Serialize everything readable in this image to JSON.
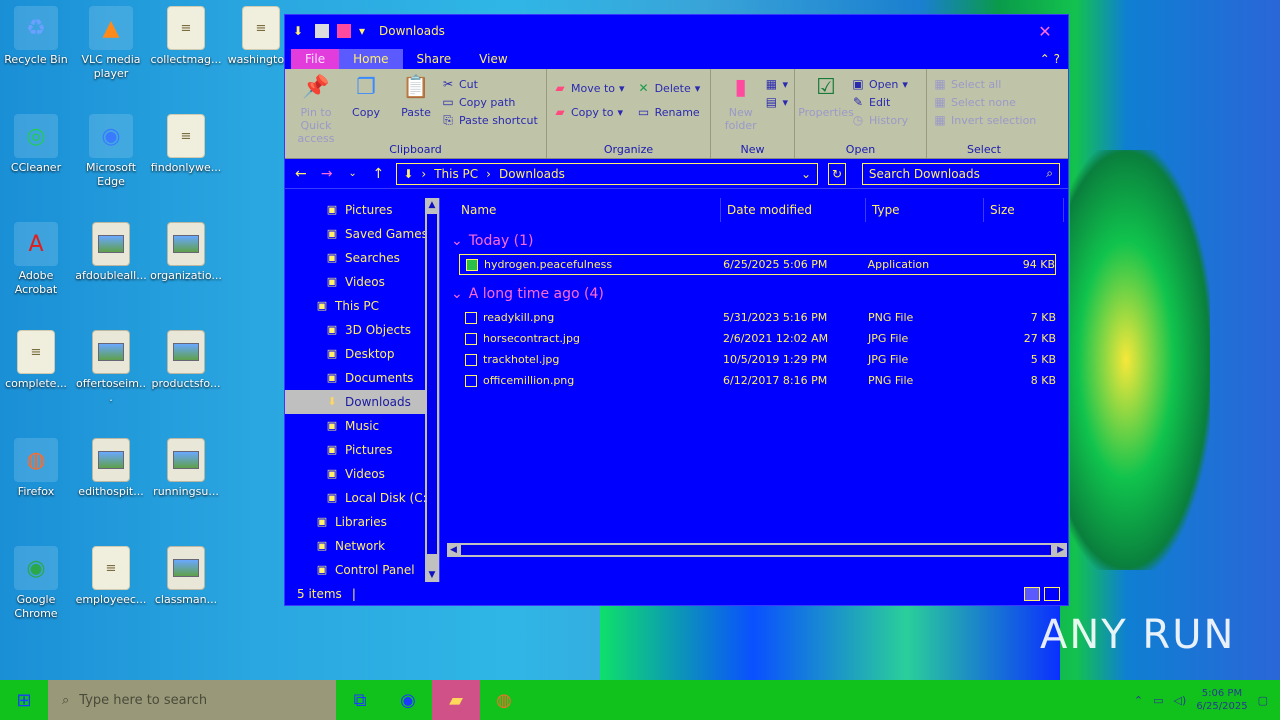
{
  "desktop": {
    "icons": [
      {
        "label": "Recycle Bin",
        "icon": "recycle-bin-icon"
      },
      {
        "label": "VLC media player",
        "icon": "vlc-icon"
      },
      {
        "label": "collectmag...",
        "icon": "document-icon"
      },
      {
        "label": "washingto...",
        "icon": "document-icon"
      },
      {
        "label": "CCleaner",
        "icon": "ccleaner-icon"
      },
      {
        "label": "Microsoft Edge",
        "icon": "edge-icon"
      },
      {
        "label": "findonlywe...",
        "icon": "document-icon"
      },
      {
        "label": "Adobe Acrobat",
        "icon": "acrobat-icon"
      },
      {
        "label": "afdoubleall...",
        "icon": "image-icon"
      },
      {
        "label": "organizatio...",
        "icon": "image-icon"
      },
      {
        "label": "complete...",
        "icon": "document-icon"
      },
      {
        "label": "offertoseim...",
        "icon": "image-icon"
      },
      {
        "label": "productsfo...",
        "icon": "image-icon"
      },
      {
        "label": "Firefox",
        "icon": "firefox-icon"
      },
      {
        "label": "edithospit...",
        "icon": "image-icon"
      },
      {
        "label": "runningsu...",
        "icon": "image-icon"
      },
      {
        "label": "Google Chrome",
        "icon": "chrome-icon"
      },
      {
        "label": "employeec...",
        "icon": "document-icon"
      },
      {
        "label": "classman...",
        "icon": "image-icon"
      }
    ]
  },
  "window": {
    "title": "Downloads",
    "tabs": {
      "file": "File",
      "home": "Home",
      "share": "Share",
      "view": "View"
    },
    "ribbon": {
      "clipboard": {
        "label": "Clipboard",
        "pin": "Pin to Quick access",
        "copy": "Copy",
        "paste": "Paste",
        "cut": "Cut",
        "copy_path": "Copy path",
        "paste_shortcut": "Paste shortcut"
      },
      "organize": {
        "label": "Organize",
        "move_to": "Move to",
        "copy_to": "Copy to",
        "delete": "Delete",
        "rename": "Rename"
      },
      "new": {
        "label": "New",
        "new_folder": "New folder"
      },
      "open": {
        "label": "Open",
        "properties": "Properties",
        "open": "Open",
        "edit": "Edit",
        "history": "History"
      },
      "select": {
        "label": "Select",
        "select_all": "Select all",
        "select_none": "Select none",
        "invert": "Invert selection"
      }
    },
    "address": {
      "parts": [
        "This PC",
        "Downloads"
      ]
    },
    "search_placeholder": "Search Downloads",
    "nav": [
      {
        "label": "Pictures",
        "icon": "pictures-icon",
        "indent": 1
      },
      {
        "label": "Saved Games",
        "icon": "saved-games-icon",
        "indent": 1
      },
      {
        "label": "Searches",
        "icon": "searches-icon",
        "indent": 1
      },
      {
        "label": "Videos",
        "icon": "videos-icon",
        "indent": 1
      },
      {
        "label": "This PC",
        "icon": "this-pc-icon",
        "indent": 0
      },
      {
        "label": "3D Objects",
        "icon": "3d-objects-icon",
        "indent": 1
      },
      {
        "label": "Desktop",
        "icon": "desktop-icon",
        "indent": 1
      },
      {
        "label": "Documents",
        "icon": "documents-icon",
        "indent": 1
      },
      {
        "label": "Downloads",
        "icon": "downloads-icon",
        "indent": 1,
        "selected": true
      },
      {
        "label": "Music",
        "icon": "music-icon",
        "indent": 1
      },
      {
        "label": "Pictures",
        "icon": "pictures-icon",
        "indent": 1
      },
      {
        "label": "Videos",
        "icon": "videos-icon",
        "indent": 1
      },
      {
        "label": "Local Disk (C:)",
        "icon": "local-disk-icon",
        "indent": 1
      },
      {
        "label": "Libraries",
        "icon": "libraries-icon",
        "indent": 0
      },
      {
        "label": "Network",
        "icon": "network-icon",
        "indent": 0
      },
      {
        "label": "Control Panel",
        "icon": "control-panel-icon",
        "indent": 0
      }
    ],
    "columns": {
      "name": "Name",
      "date": "Date modified",
      "type": "Type",
      "size": "Size"
    },
    "groups": [
      {
        "title": "Today (1)",
        "files": [
          {
            "name": "hydrogen.peacefulness",
            "date": "6/25/2025 5:06 PM",
            "type": "Application",
            "size": "94 KB",
            "selected": true
          }
        ]
      },
      {
        "title": "A long time ago (4)",
        "files": [
          {
            "name": "readykill.png",
            "date": "5/31/2023 5:16 PM",
            "type": "PNG File",
            "size": "7 KB"
          },
          {
            "name": "horsecontract.jpg",
            "date": "2/6/2021 12:02 AM",
            "type": "JPG File",
            "size": "27 KB"
          },
          {
            "name": "trackhotel.jpg",
            "date": "10/5/2019 1:29 PM",
            "type": "JPG File",
            "size": "5 KB"
          },
          {
            "name": "officemillion.png",
            "date": "6/12/2017 8:16 PM",
            "type": "PNG File",
            "size": "8 KB"
          }
        ]
      }
    ],
    "status": "5 items"
  },
  "taskbar": {
    "search_placeholder": "Type here to search",
    "time": "5:06 PM",
    "date": "6/25/2025"
  },
  "watermark": "ANY RUN"
}
